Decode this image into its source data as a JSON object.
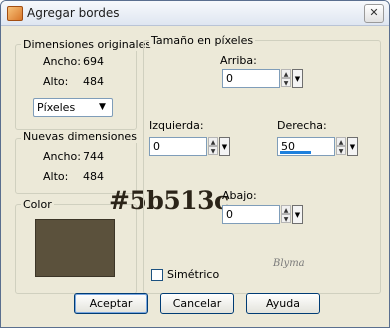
{
  "window": {
    "title": "Agregar bordes",
    "icon": "app-icon",
    "close_glyph": "✕"
  },
  "dimensiones_originales": {
    "legend": "Dimensiones originales",
    "ancho_label": "Ancho:",
    "ancho_value": "694",
    "alto_label": "Alto:",
    "alto_value": "484",
    "units": "Píxeles"
  },
  "nuevas_dimensiones": {
    "legend": "Nuevas dimensiones",
    "ancho_label": "Ancho:",
    "ancho_value": "744",
    "alto_label": "Alto:",
    "alto_value": "484"
  },
  "color": {
    "legend": "Color",
    "swatch": "#5b513c",
    "hex_overlay": "#5b513c"
  },
  "tamano": {
    "legend": "Tamaño en píxeles",
    "arriba_label": "Arriba:",
    "arriba_value": "0",
    "izquierda_label": "Izquierda:",
    "izquierda_value": "0",
    "derecha_label": "Derecha:",
    "derecha_value": "50",
    "abajo_label": "Abajo:",
    "abajo_value": "0",
    "simetrico_label": "Simétrico",
    "simetrico_checked": false
  },
  "signature": "Blyma",
  "buttons": {
    "aceptar": "Aceptar",
    "cancelar": "Cancelar",
    "ayuda": "Ayuda"
  }
}
